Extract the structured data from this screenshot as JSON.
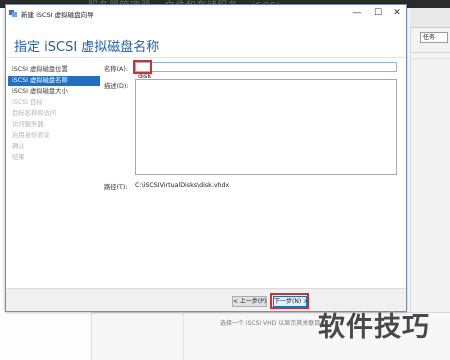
{
  "background": {
    "title_text": "服务器管理器 • 文件和存储服务 • iSCSI",
    "tasks_label": "任务",
    "status_text": "选择一个 iSCSI VHD 以显示其关联目",
    "watermark": "软件技巧"
  },
  "dialog": {
    "title": "新建 iSCSI 虚拟磁盘向导",
    "window_controls": {
      "minimize": "—",
      "maximize": "☐",
      "close": "✕"
    },
    "page_title": "指定 iSCSI 虚拟磁盘名称",
    "nav_items": [
      {
        "label": "iSCSI 虚拟磁盘位置",
        "state": "normal"
      },
      {
        "label": "iSCSI 虚拟磁盘名称",
        "state": "active"
      },
      {
        "label": "iSCSI 虚拟磁盘大小",
        "state": "normal"
      },
      {
        "label": "iSCSI 目标",
        "state": "disabled"
      },
      {
        "label": "目标名称和访问",
        "state": "disabled"
      },
      {
        "label": "访问服务器",
        "state": "disabled"
      },
      {
        "label": "启用身份验证",
        "state": "disabled"
      },
      {
        "label": "确认",
        "state": "disabled"
      },
      {
        "label": "结果",
        "state": "disabled"
      }
    ],
    "form": {
      "name_label": "名称(A):",
      "name_value": "disk",
      "description_label": "描述(D):",
      "description_value": "",
      "path_label": "路径(T):",
      "path_value": "C:\\iSCSIVirtualDisks\\disk.vhdx"
    },
    "buttons": {
      "prev": "< 上一步(P)",
      "next": "下一步(N) >"
    },
    "colors": {
      "accent": "#1f6fc2",
      "title": "#1f5fa8",
      "highlight": "#d32f2f"
    }
  }
}
